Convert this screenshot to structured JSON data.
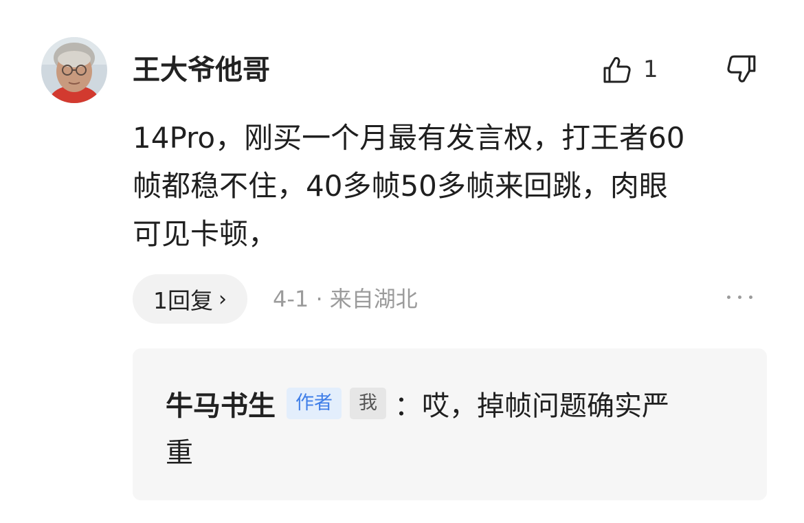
{
  "comment": {
    "author": "王大爷他哥",
    "like_count": "1",
    "text_lines": [
      "14Pro，刚买一个月最有发言权，打王者60",
      "帧都稳不住，40多帧50多帧来回跳，肉眼",
      "可见卡顿，"
    ],
    "reply_button_label": "1回复",
    "reply_button_chevron": "›",
    "date": "4-1",
    "separator": "·",
    "location": "来自湖北"
  },
  "reply": {
    "author": "牛马书生",
    "author_tag": "作者",
    "me_tag": "我",
    "text_line1": "：哎，掉帧问题确实严",
    "text_line2": "重"
  },
  "icons": {
    "like": "thumbs-up-icon",
    "dislike": "thumbs-down-icon",
    "more": "more-dots-icon"
  },
  "colors": {
    "author_tag_bg": "#e3eefc",
    "author_tag_text": "#3f7ee8",
    "meta_text": "#9b9b9b",
    "reply_box_bg": "#f6f6f6"
  }
}
